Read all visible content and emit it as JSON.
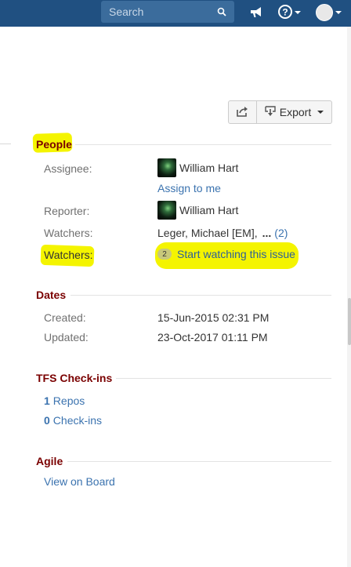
{
  "header": {
    "search_placeholder": "Search",
    "icons": [
      "search-icon",
      "megaphone-icon",
      "help-icon",
      "user-avatar"
    ]
  },
  "toolbar": {
    "share_icon": "share-icon",
    "export_label": "Export"
  },
  "people": {
    "heading": "People",
    "assignee_label": "Assignee:",
    "assignee_name": "William Hart",
    "assign_to_me": "Assign to me",
    "reporter_label": "Reporter:",
    "reporter_name": "William Hart",
    "watchers_label": "Watchers:",
    "watchers_names": "Leger, Michael [EM],",
    "watchers_more": "...",
    "watchers_count": "(2)",
    "watch_label": "Watchers:",
    "watch_badge": "2",
    "watch_action": "Start watching this issue"
  },
  "dates": {
    "heading": "Dates",
    "created_label": "Created:",
    "created_value": "15-Jun-2015 02:31 PM",
    "updated_label": "Updated:",
    "updated_value": "23-Oct-2017 01:11 PM"
  },
  "tfs": {
    "heading": "TFS Check-ins",
    "repos_count": "1",
    "repos_label": "Repos",
    "checkins_count": "0",
    "checkins_label": "Check-ins"
  },
  "agile": {
    "heading": "Agile",
    "view_on_board": "View on Board"
  },
  "colors": {
    "header_bg": "#205081",
    "section_heading": "#7a0000",
    "link": "#3b73af",
    "highlight": "#f4f400"
  }
}
